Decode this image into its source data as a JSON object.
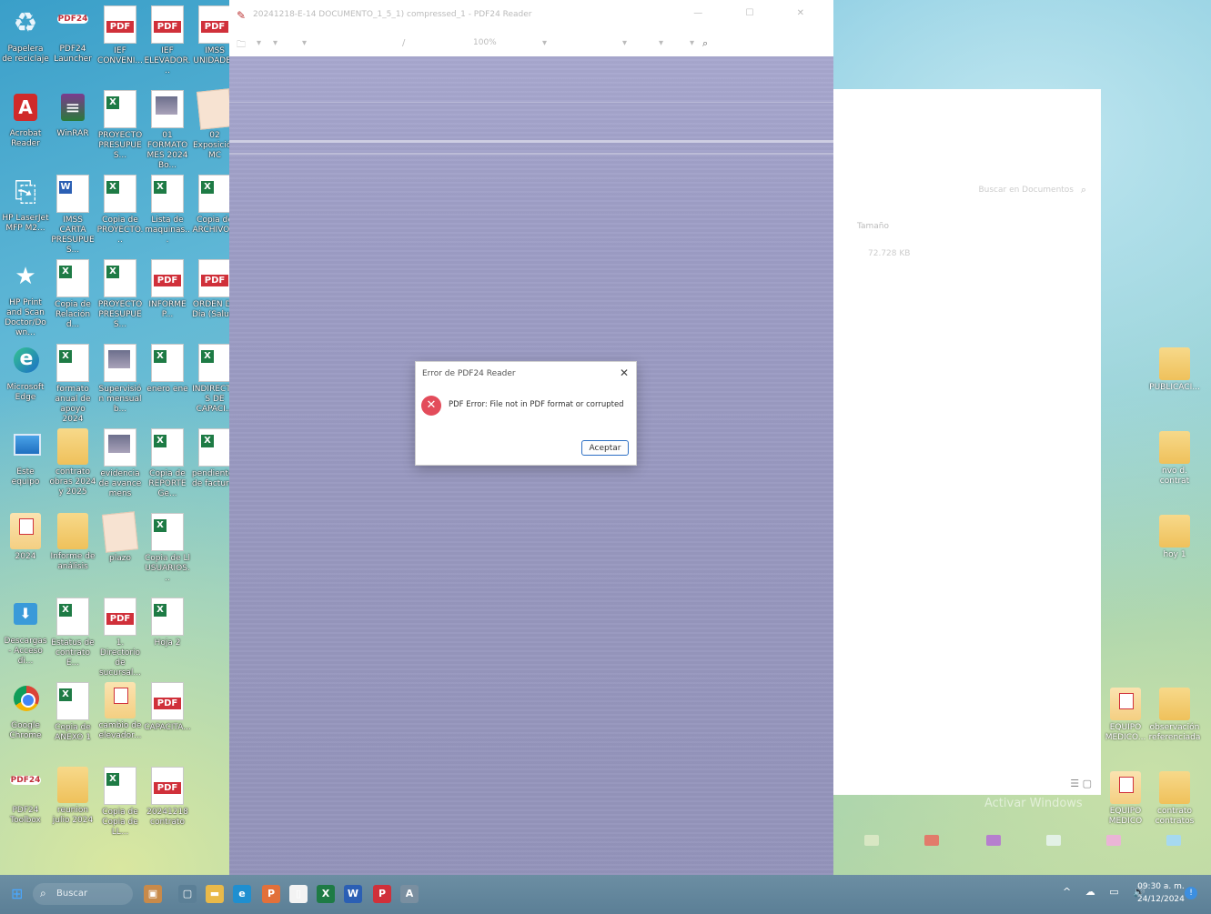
{
  "desktop": {
    "icons": [
      {
        "label": "Papelera de reciclaje",
        "type": "recycle"
      },
      {
        "label": "PDF24 Launcher",
        "type": "pdf24"
      },
      {
        "label": "IEF CONVENI...",
        "type": "pdf"
      },
      {
        "label": "IEF ELEVADOR...",
        "type": "pdf"
      },
      {
        "label": "IMSS UNIDADES",
        "type": "pdf"
      },
      {
        "label": "Acrobat Reader",
        "type": "acrobat"
      },
      {
        "label": "WinRAR",
        "type": "winrar"
      },
      {
        "label": "PROYECTO PRESUPUES...",
        "type": "xls"
      },
      {
        "label": "01 FORMATO MES 2024 Bo...",
        "type": "img"
      },
      {
        "label": "02 Exposición MC",
        "type": "plain"
      },
      {
        "label": "HP LaserJet MFP M2...",
        "type": "scan"
      },
      {
        "label": "IMSS CARTA PRESUPUES...",
        "type": "doc"
      },
      {
        "label": "Copia de PROYECTO...",
        "type": "xls"
      },
      {
        "label": "Lista de maquinas...",
        "type": "xls"
      },
      {
        "label": "Copia de ARCHIVO...",
        "type": "xls"
      },
      {
        "label": "HP Print and Scan Doctor/Down...",
        "type": "star"
      },
      {
        "label": "Copia de Relación d...",
        "type": "xls"
      },
      {
        "label": "PROYECTO PRESUPUES...",
        "type": "xls"
      },
      {
        "label": "INFORME P...",
        "type": "pdf"
      },
      {
        "label": "ORDEN DE Día (Salud)",
        "type": "pdf"
      },
      {
        "label": "Microsoft Edge",
        "type": "edge"
      },
      {
        "label": "formato anual de apoyo 2024",
        "type": "xls"
      },
      {
        "label": "Supervisión mensual b...",
        "type": "img"
      },
      {
        "label": "enero ene",
        "type": "xls"
      },
      {
        "label": "INDIRECTOS DE CAPACI...",
        "type": "xls"
      },
      {
        "label": "Este equipo",
        "type": "pc"
      },
      {
        "label": "contrato obras 2024 y 2025",
        "type": "folder"
      },
      {
        "label": "evidencia de avance mens",
        "type": "img"
      },
      {
        "label": "Copia de REPORTE Ge...",
        "type": "xls"
      },
      {
        "label": "pendientes de facturar",
        "type": "xls"
      },
      {
        "label": "2024",
        "type": "folder-pdf"
      },
      {
        "label": "Informe de análisis",
        "type": "folder"
      },
      {
        "label": "plazo",
        "type": "plain"
      },
      {
        "label": "Copia de Ll USUARIOS...",
        "type": "xls"
      },
      {
        "label": "",
        "type": "none"
      },
      {
        "label": "Descargas - Acceso di...",
        "type": "download"
      },
      {
        "label": "Estatus de contrato E...",
        "type": "xls"
      },
      {
        "label": "1. Directorio de sucursal...",
        "type": "pdf"
      },
      {
        "label": "Hoja 2",
        "type": "xls"
      },
      {
        "label": "",
        "type": "none"
      },
      {
        "label": "Google Chrome",
        "type": "chrome"
      },
      {
        "label": "Copia de ANEXO 1",
        "type": "xls"
      },
      {
        "label": "cambio de elevador...",
        "type": "folder-pdf"
      },
      {
        "label": "CAPACITA...",
        "type": "pdf"
      },
      {
        "label": "",
        "type": "none"
      },
      {
        "label": "PDF24 Toolbox",
        "type": "pdf24"
      },
      {
        "label": "reunion julio 2024",
        "type": "folder"
      },
      {
        "label": "Copia de Copia de LL...",
        "type": "xls"
      },
      {
        "label": "20241218 contrato",
        "type": "pdf"
      }
    ],
    "right_icons": [
      {
        "label": "PUBLICACI..."
      },
      {
        "label": "nvo d. contrat"
      },
      {
        "label": "hoy 1"
      },
      {
        "label": "EQUIPO MEDICO..."
      },
      {
        "label": "observación referenciada"
      },
      {
        "label": "EQUIPO MEDICO"
      },
      {
        "label": "contrato contratos"
      }
    ],
    "watermark": "Activar Windows"
  },
  "pdf_window": {
    "title": "20241218-E-14 DOCUMENTO_1_5_1) compressed_1 - PDF24 Reader",
    "zoom": "100%",
    "window_buttons": "—  ☐  ✕"
  },
  "bg_window": {
    "search_placeholder": "Buscar en Documentos",
    "size_label": "Tamaño",
    "size_value": "72.728 KB"
  },
  "dialog": {
    "title": "Error de PDF24 Reader",
    "message": "PDF Error: File not in PDF format or corrupted",
    "button": "Aceptar"
  },
  "taskbar": {
    "search_label": "Buscar",
    "time": "09:30 a. m.",
    "date": "24/12/2024",
    "apps": [
      {
        "name": "task-app-widgets",
        "glyph": "▣",
        "color": "#c88a4a"
      },
      {
        "name": "task-app-taskview",
        "glyph": "▢",
        "color": "#5b7f96"
      },
      {
        "name": "task-app-explorer",
        "glyph": "▬",
        "color": "#e9b949"
      },
      {
        "name": "task-app-edge",
        "glyph": "e",
        "color": "#1f8fd0"
      },
      {
        "name": "task-app-pdf",
        "glyph": "P",
        "color": "#e2703a"
      },
      {
        "name": "task-app-notepad",
        "glyph": "▯",
        "color": "#f3f3f3"
      },
      {
        "name": "task-app-excel",
        "glyph": "X",
        "color": "#1e7b45"
      },
      {
        "name": "task-app-word",
        "glyph": "W",
        "color": "#2b5fb4"
      },
      {
        "name": "task-app-pdf24",
        "glyph": "P",
        "color": "#d0303a"
      },
      {
        "name": "task-app-acrobat",
        "glyph": "A",
        "color": "#7a8fa0"
      }
    ]
  }
}
